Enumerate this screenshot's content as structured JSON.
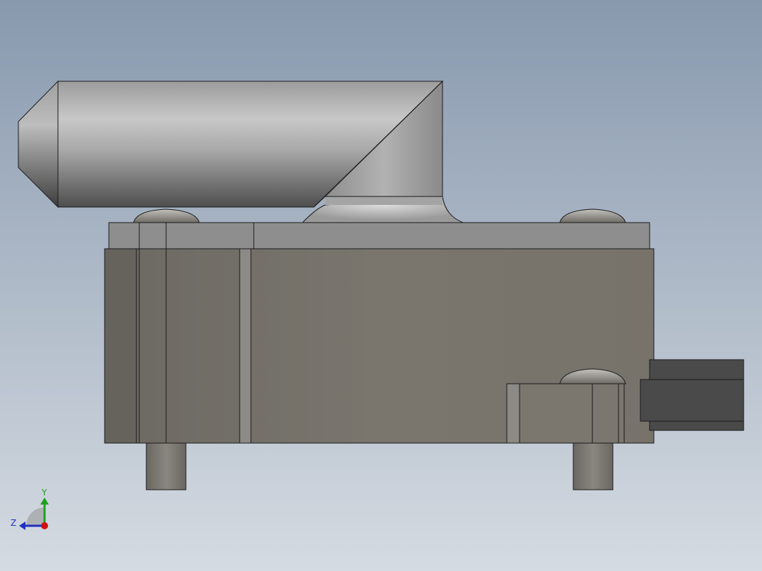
{
  "viewport": {
    "background_top": "#8a9bb0",
    "background_bottom": "#d3d9e0"
  },
  "model": {
    "body_color": "#7a766e",
    "top_plate_color": "#8e8e8e",
    "nozzle_color": "#a9a9a9",
    "connector_color": "#4a4a4a",
    "edge_color": "#1a1a1a"
  },
  "triad": {
    "y_label": "Y",
    "z_label": "Z",
    "y_color": "#1fa01f",
    "z_color": "#1f2fc0",
    "x_color": "#d01010"
  }
}
